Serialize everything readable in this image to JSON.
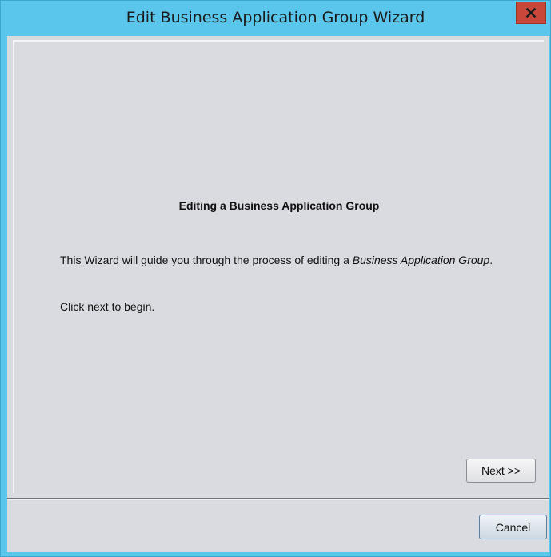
{
  "window": {
    "title": "Edit Business Application Group Wizard",
    "close_icon": "close-icon"
  },
  "content": {
    "heading": "Editing a Business Application Group",
    "intro_prefix": "This Wizard will guide you through the process of editing a ",
    "intro_emphasis": "Business Application Group",
    "intro_suffix": ".",
    "instruction": "Click next to begin."
  },
  "buttons": {
    "next_label": "Next >>",
    "cancel_label": "Cancel"
  },
  "colors": {
    "frame": "#5ac6ec",
    "client": "#dadbe0",
    "close_button": "#c8473a"
  }
}
